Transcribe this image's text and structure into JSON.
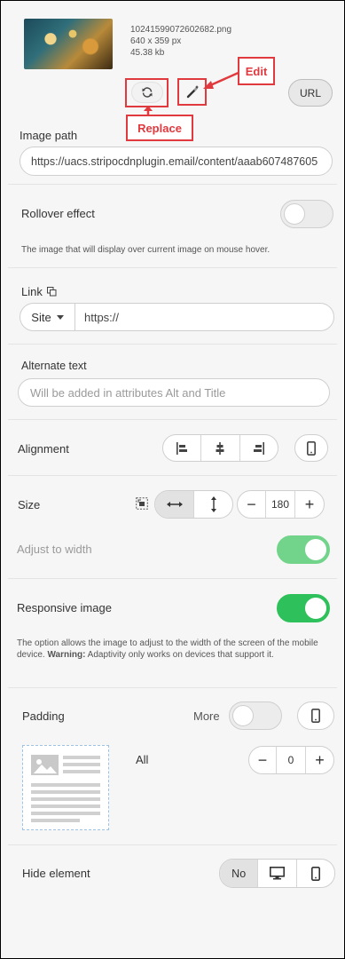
{
  "file": {
    "name": "10241599072602682.png",
    "dimensions": "640 x 359 px",
    "size": "45.38 kb"
  },
  "toolbar": {
    "url_label": "URL",
    "callout_edit": "Edit",
    "callout_replace": "Replace"
  },
  "image_path": {
    "label": "Image path",
    "value": "https://uacs.stripocdnplugin.email/content/aaab607487605"
  },
  "rollover": {
    "label": "Rollover effect",
    "description": "The image that will display over current image on mouse hover.",
    "enabled": false
  },
  "link": {
    "label": "Link",
    "type_value": "Site",
    "url_placeholder": "https://"
  },
  "alt": {
    "label": "Alternate text",
    "placeholder": "Will be added in attributes Alt and Title"
  },
  "alignment": {
    "label": "Alignment",
    "options": [
      "align-left-icon",
      "align-center-icon",
      "align-right-icon"
    ]
  },
  "size": {
    "label": "Size",
    "value": "180",
    "adjust_label": "Adjust to width",
    "adjust_enabled": true
  },
  "responsive": {
    "label": "Responsive image",
    "enabled": true,
    "desc_pre": "The option allows the image to adjust to the width of the screen of the mobile device. ",
    "desc_warning": "Warning:",
    "desc_post": " Adaptivity only works on devices that support it."
  },
  "padding": {
    "label": "Padding",
    "more_label": "More",
    "all_label": "All",
    "value": "0",
    "more_enabled": false
  },
  "hide": {
    "label": "Hide element",
    "no_label": "No"
  },
  "colors": {
    "accent_green": "#2ec05a",
    "callout_red": "#e0393e"
  }
}
